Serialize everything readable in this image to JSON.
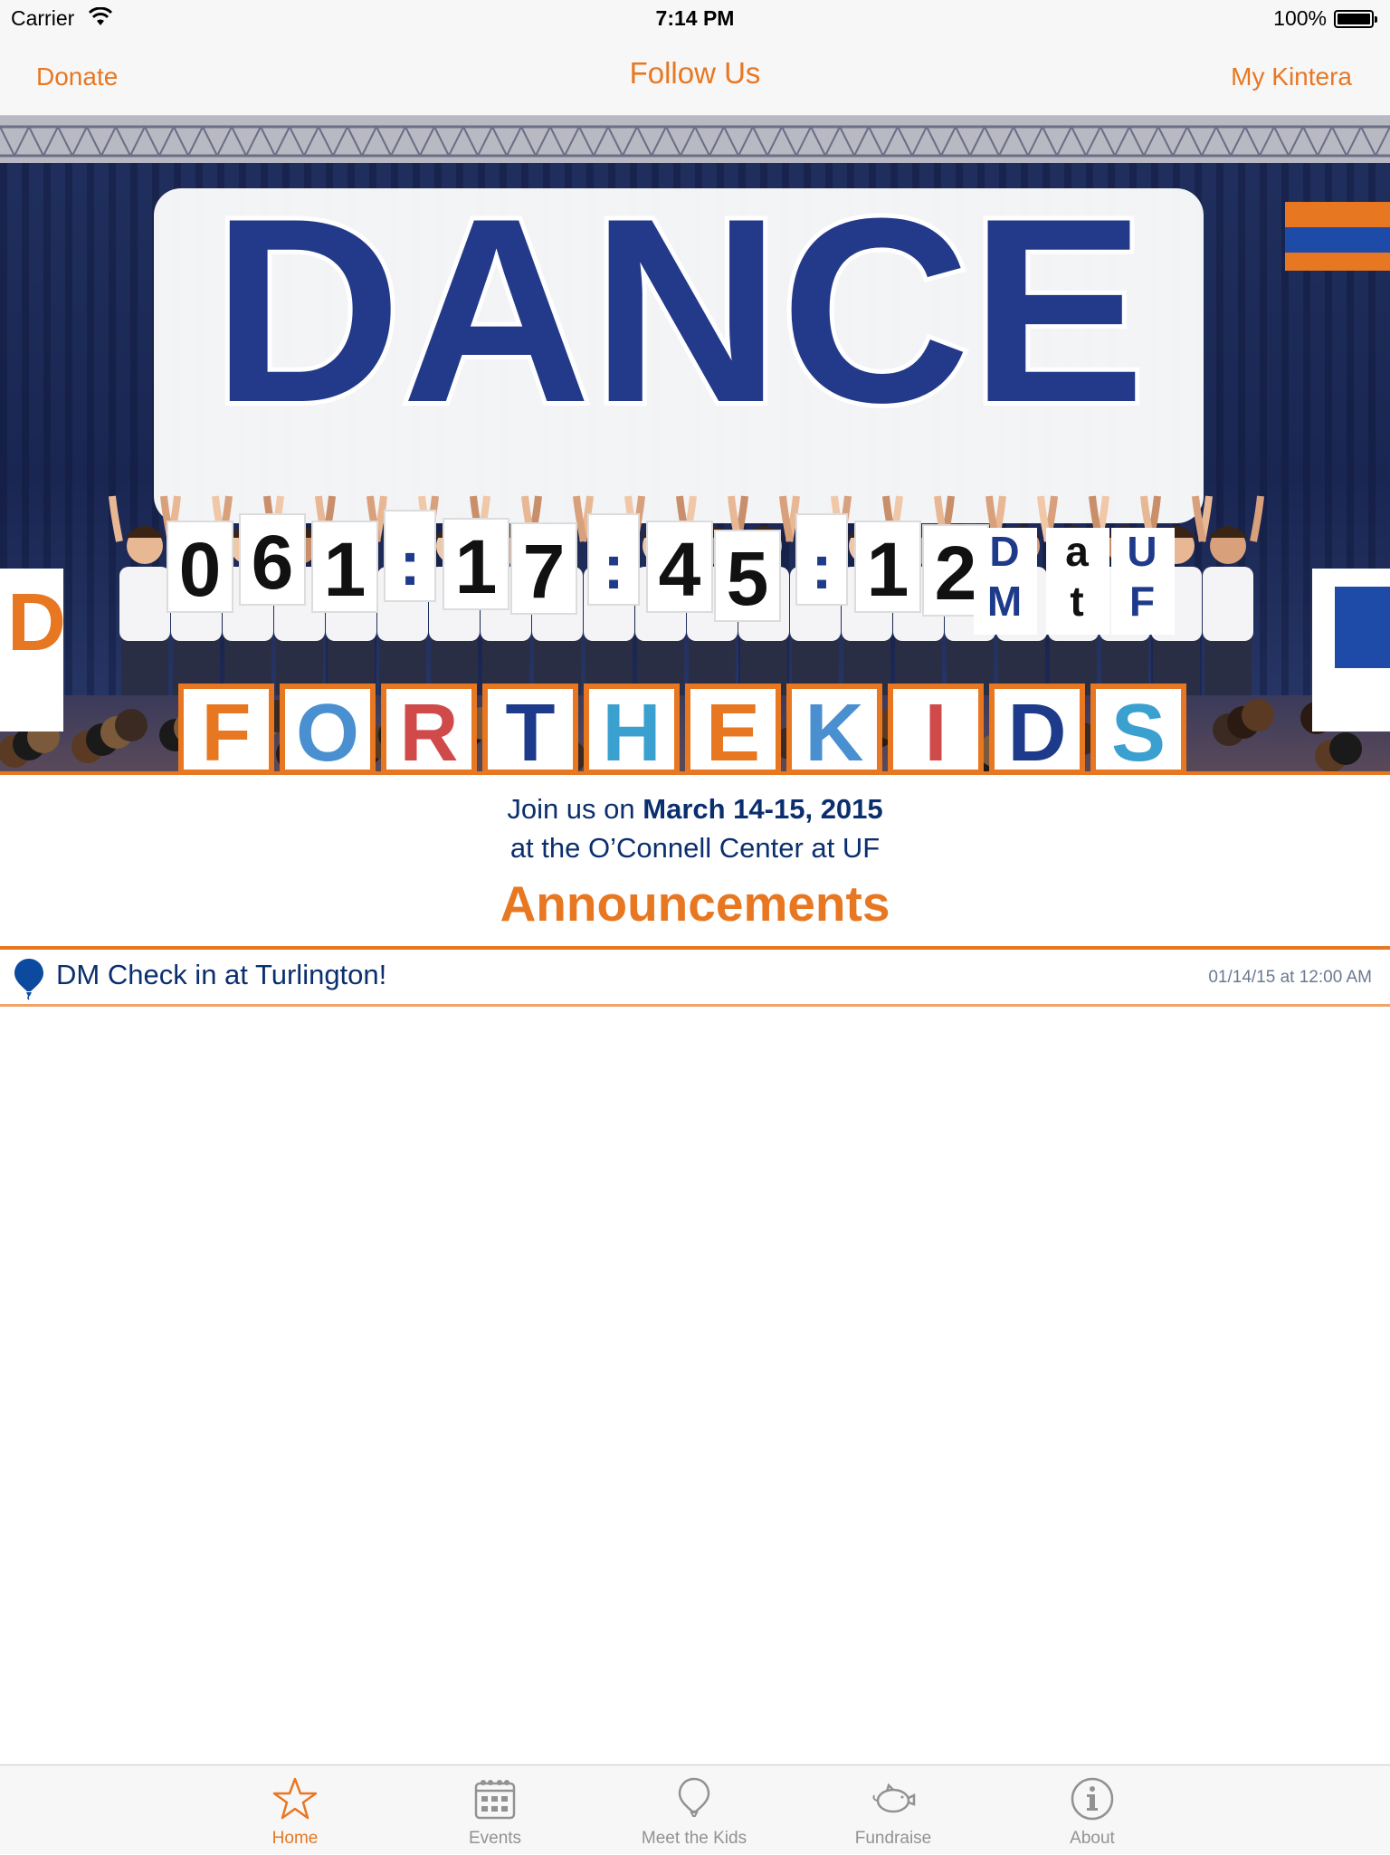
{
  "status_bar": {
    "carrier": "Carrier",
    "time": "7:14 PM",
    "battery": "100%"
  },
  "nav": {
    "left_button": "Donate",
    "title": "Follow Us",
    "right_button": "My Kintera"
  },
  "hero": {
    "banner_word": "DANCE",
    "countdown_cards": [
      "0",
      "6",
      "1",
      ":",
      "1",
      "7",
      ":",
      "4",
      "5",
      ":",
      "1",
      "2"
    ],
    "logo_letters": [
      "D",
      "a",
      "U",
      "M",
      "t",
      "F"
    ],
    "bottom_sign": [
      "F",
      "O",
      "R",
      "T",
      "H",
      "E",
      "K",
      "I",
      "D",
      "S"
    ]
  },
  "event": {
    "line1_prefix": "Join us on ",
    "line1_date": "March 14-15, 2015",
    "line2": "at the O’Connell Center at UF"
  },
  "announcements": {
    "heading": "Announcements",
    "items": [
      {
        "title": "DM Check in at Turlington!",
        "date": "01/14/15 at 12:00 AM"
      }
    ]
  },
  "tabs": [
    {
      "label": "Home",
      "icon": "star-icon",
      "active": true
    },
    {
      "label": "Events",
      "icon": "calendar-icon",
      "active": false
    },
    {
      "label": "Meet the Kids",
      "icon": "balloon-icon",
      "active": false
    },
    {
      "label": "Fundraise",
      "icon": "piggy-bank-icon",
      "active": false
    },
    {
      "label": "About",
      "icon": "info-icon",
      "active": false
    }
  ],
  "colors": {
    "accent_orange": "#e87722",
    "navy": "#0b2f6e",
    "tab_inactive": "#929292",
    "bar_background": "#f7f7f7"
  }
}
